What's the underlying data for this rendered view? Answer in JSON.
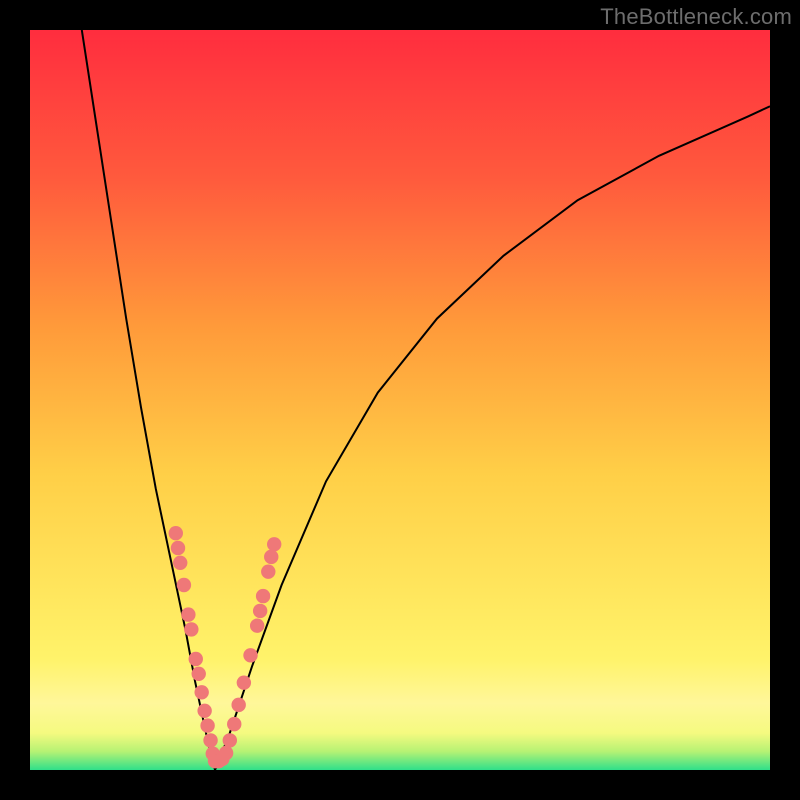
{
  "watermark": "TheBottleneck.com",
  "colors": {
    "frame": "#000000",
    "curve": "#000000",
    "dot_fill": "#ef7878",
    "dot_stroke": "#c54a4a",
    "green": "#2fe08a",
    "yellow": "#fff36a",
    "orange": "#ff9a3a",
    "red": "#ff2d3e"
  },
  "chart_data": {
    "type": "line",
    "title": "",
    "xlabel": "",
    "ylabel": "",
    "xlim": [
      0,
      1
    ],
    "ylim": [
      0,
      1
    ],
    "x_vertex": 0.25,
    "series": [
      {
        "name": "left-curve",
        "x": [
          0.07,
          0.09,
          0.11,
          0.13,
          0.15,
          0.17,
          0.19,
          0.21,
          0.223,
          0.24,
          0.25
        ],
        "y": [
          1.0,
          0.87,
          0.74,
          0.61,
          0.49,
          0.38,
          0.285,
          0.19,
          0.12,
          0.04,
          0.0
        ]
      },
      {
        "name": "right-curve",
        "x": [
          0.25,
          0.27,
          0.3,
          0.34,
          0.4,
          0.47,
          0.55,
          0.64,
          0.74,
          0.85,
          0.97,
          1.0
        ],
        "y": [
          0.0,
          0.05,
          0.14,
          0.25,
          0.39,
          0.51,
          0.61,
          0.695,
          0.77,
          0.83,
          0.883,
          0.897
        ]
      }
    ],
    "annotations": {
      "name": "salmon-dots",
      "points": [
        {
          "x": 0.197,
          "y": 0.32
        },
        {
          "x": 0.2,
          "y": 0.3
        },
        {
          "x": 0.203,
          "y": 0.28
        },
        {
          "x": 0.208,
          "y": 0.25
        },
        {
          "x": 0.214,
          "y": 0.21
        },
        {
          "x": 0.218,
          "y": 0.19
        },
        {
          "x": 0.224,
          "y": 0.15
        },
        {
          "x": 0.228,
          "y": 0.13
        },
        {
          "x": 0.232,
          "y": 0.105
        },
        {
          "x": 0.236,
          "y": 0.08
        },
        {
          "x": 0.24,
          "y": 0.06
        },
        {
          "x": 0.244,
          "y": 0.04
        },
        {
          "x": 0.247,
          "y": 0.022
        },
        {
          "x": 0.25,
          "y": 0.012
        },
        {
          "x": 0.255,
          "y": 0.012
        },
        {
          "x": 0.26,
          "y": 0.015
        },
        {
          "x": 0.265,
          "y": 0.023
        },
        {
          "x": 0.27,
          "y": 0.04
        },
        {
          "x": 0.276,
          "y": 0.062
        },
        {
          "x": 0.282,
          "y": 0.088
        },
        {
          "x": 0.289,
          "y": 0.118
        },
        {
          "x": 0.298,
          "y": 0.155
        },
        {
          "x": 0.307,
          "y": 0.195
        },
        {
          "x": 0.311,
          "y": 0.215
        },
        {
          "x": 0.315,
          "y": 0.235
        },
        {
          "x": 0.322,
          "y": 0.268
        },
        {
          "x": 0.326,
          "y": 0.288
        },
        {
          "x": 0.33,
          "y": 0.305
        }
      ]
    },
    "background_bands": [
      {
        "y": 0.0,
        "color": "#2fe08a"
      },
      {
        "y": 0.025,
        "color": "#b6f274"
      },
      {
        "y": 0.05,
        "color": "#f5fa80"
      },
      {
        "y": 0.09,
        "color": "#fff79a"
      },
      {
        "y": 0.15,
        "color": "#fff36a"
      },
      {
        "y": 0.4,
        "color": "#ffcf47"
      },
      {
        "y": 0.6,
        "color": "#ff9a3a"
      },
      {
        "y": 0.8,
        "color": "#ff5a3d"
      },
      {
        "y": 1.0,
        "color": "#ff2d3e"
      }
    ]
  }
}
